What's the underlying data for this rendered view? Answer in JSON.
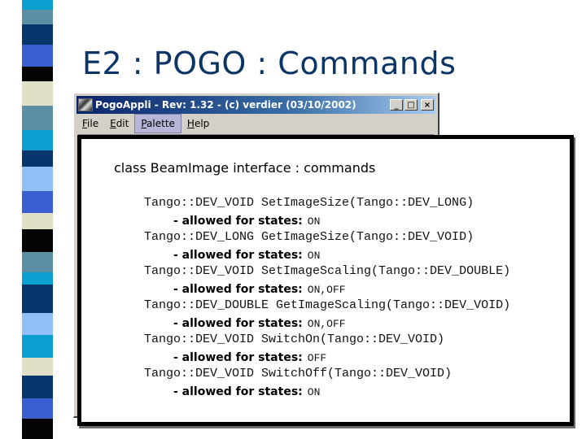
{
  "slide": {
    "title": "E2 : POGO : Commands"
  },
  "decor": {
    "stripe_colors": {
      "cyan": "#0aa0d0",
      "slate": "#5b8fa6",
      "navy": "#06366b",
      "royal": "#3a5fd0",
      "black": "#050505",
      "beige": "#e0e0c6",
      "light": "#90c0f5"
    }
  },
  "app_window": {
    "title": "PogoAppli - Rev: 1.32 - (c) verdier (03/10/2002)",
    "minimize_label": "_",
    "maximize_label": "□",
    "close_label": "×",
    "menu": [
      {
        "label": "File",
        "mnemonic": "F"
      },
      {
        "label": "Edit",
        "mnemonic": "E"
      },
      {
        "label": "Palette",
        "mnemonic": "P",
        "active": true
      },
      {
        "label": "Help",
        "mnemonic": "H"
      }
    ]
  },
  "commands_panel": {
    "heading": "class BeamImage interface : commands",
    "allowed_label": "- allowed for states:",
    "commands": [
      {
        "signature": "Tango::DEV_VOID SetImageSize(Tango::DEV_LONG)",
        "states": "ON"
      },
      {
        "signature": "Tango::DEV_LONG GetImageSize(Tango::DEV_VOID)",
        "states": "ON"
      },
      {
        "signature": "Tango::DEV_VOID SetImageScaling(Tango::DEV_DOUBLE)",
        "states": "ON,OFF"
      },
      {
        "signature": "Tango::DEV_DOUBLE GetImageScaling(Tango::DEV_VOID)",
        "states": "ON,OFF"
      },
      {
        "signature": "Tango::DEV_VOID SwitchOn(Tango::DEV_VOID)",
        "states": "OFF"
      },
      {
        "signature": "Tango::DEV_VOID SwitchOff(Tango::DEV_VOID)",
        "states": "ON"
      }
    ]
  }
}
